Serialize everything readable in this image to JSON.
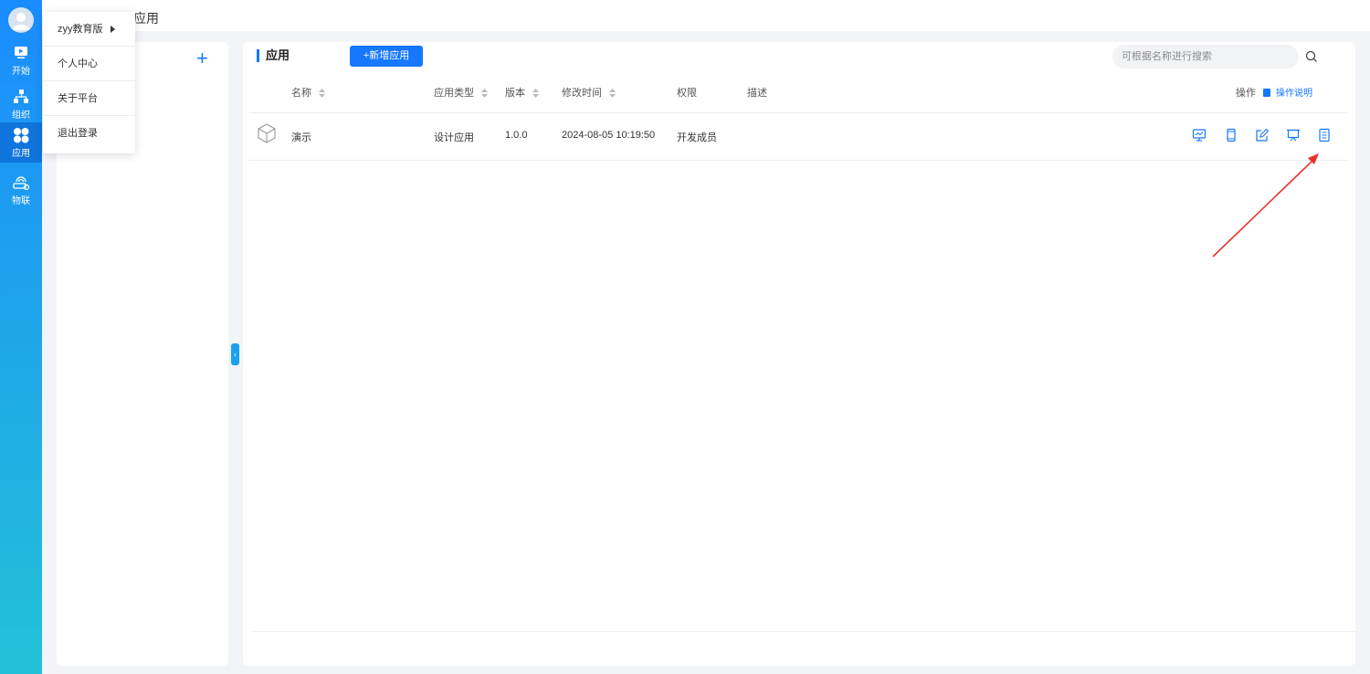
{
  "rail": {
    "items": [
      {
        "label": "开始",
        "icon": "play-icon"
      },
      {
        "label": "组织",
        "icon": "org-chart-icon"
      },
      {
        "label": "应用",
        "icon": "apps-grid-icon"
      },
      {
        "label": "物联",
        "icon": "iot-device-icon"
      }
    ]
  },
  "topbar": {
    "crumb": "应用"
  },
  "menu": {
    "items": [
      {
        "label": "zyy教育版"
      },
      {
        "label": "个人中心"
      },
      {
        "label": "关于平台"
      },
      {
        "label": "退出登录"
      }
    ]
  },
  "main": {
    "title": "应用",
    "add_button": "新增应用",
    "search_placeholder": "可根据名称进行搜索",
    "help_label": "操作说明",
    "columns": [
      "名称",
      "应用类型",
      "版本",
      "修改时间",
      "权限",
      "描述",
      "操作"
    ],
    "rows": [
      {
        "name": "演示",
        "type": "设计应用",
        "version": "1.0.0",
        "modified": "2024-08-05 10:19:50",
        "permission": "开发成员",
        "description": ""
      }
    ]
  },
  "colors": {
    "accent": "#1677ff",
    "rail_top": "#1a8cff",
    "rail_bottom": "#23c1d8",
    "arrow": "#e8322b"
  }
}
